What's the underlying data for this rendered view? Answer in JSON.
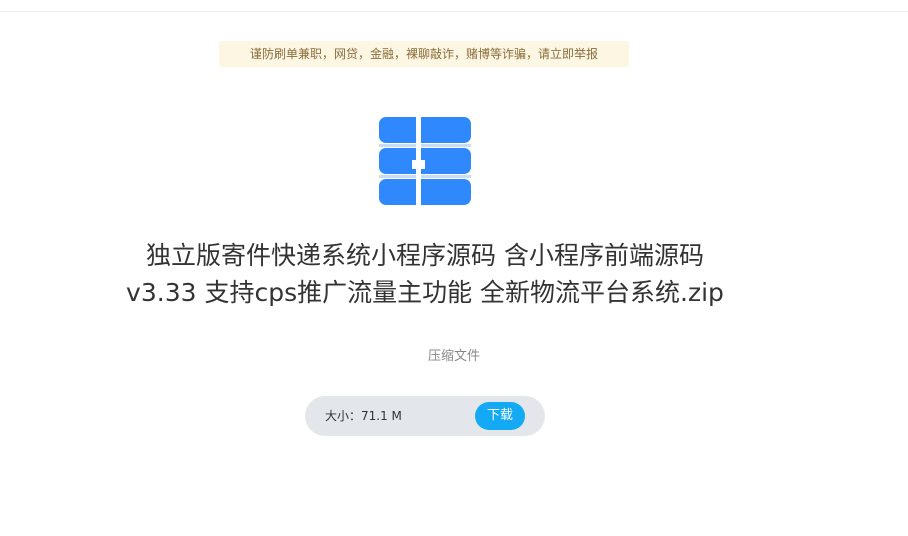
{
  "notice": {
    "text": "谨防刷单兼职，网贷，金融，裸聊敲诈，赌博等诈骗，请立即举报"
  },
  "file": {
    "icon": "zip-archive-icon",
    "icon_color": "#2f89fc",
    "title": "独立版寄件快递系统小程序源码 含小程序前端源码v3.33 支持cps推广流量主功能 全新物流平台系统.zip",
    "type": "压缩文件"
  },
  "download": {
    "size_label": "大小：",
    "size_value": "71.1 M",
    "button_label": "下载",
    "button_color": "#14a9f5"
  }
}
